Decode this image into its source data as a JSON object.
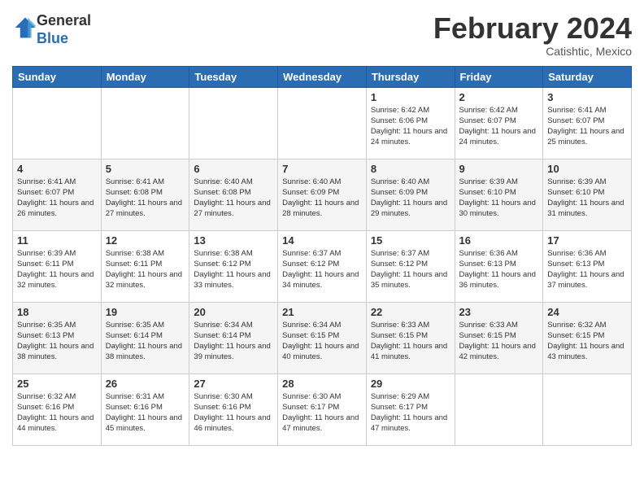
{
  "header": {
    "logo_general": "General",
    "logo_blue": "Blue",
    "month_title": "February 2024",
    "subtitle": "Catishtic, Mexico"
  },
  "days_of_week": [
    "Sunday",
    "Monday",
    "Tuesday",
    "Wednesday",
    "Thursday",
    "Friday",
    "Saturday"
  ],
  "weeks": [
    [
      {
        "day": "",
        "info": ""
      },
      {
        "day": "",
        "info": ""
      },
      {
        "day": "",
        "info": ""
      },
      {
        "day": "",
        "info": ""
      },
      {
        "day": "1",
        "info": "Sunrise: 6:42 AM\nSunset: 6:06 PM\nDaylight: 11 hours and 24 minutes."
      },
      {
        "day": "2",
        "info": "Sunrise: 6:42 AM\nSunset: 6:07 PM\nDaylight: 11 hours and 24 minutes."
      },
      {
        "day": "3",
        "info": "Sunrise: 6:41 AM\nSunset: 6:07 PM\nDaylight: 11 hours and 25 minutes."
      }
    ],
    [
      {
        "day": "4",
        "info": "Sunrise: 6:41 AM\nSunset: 6:07 PM\nDaylight: 11 hours and 26 minutes."
      },
      {
        "day": "5",
        "info": "Sunrise: 6:41 AM\nSunset: 6:08 PM\nDaylight: 11 hours and 27 minutes."
      },
      {
        "day": "6",
        "info": "Sunrise: 6:40 AM\nSunset: 6:08 PM\nDaylight: 11 hours and 27 minutes."
      },
      {
        "day": "7",
        "info": "Sunrise: 6:40 AM\nSunset: 6:09 PM\nDaylight: 11 hours and 28 minutes."
      },
      {
        "day": "8",
        "info": "Sunrise: 6:40 AM\nSunset: 6:09 PM\nDaylight: 11 hours and 29 minutes."
      },
      {
        "day": "9",
        "info": "Sunrise: 6:39 AM\nSunset: 6:10 PM\nDaylight: 11 hours and 30 minutes."
      },
      {
        "day": "10",
        "info": "Sunrise: 6:39 AM\nSunset: 6:10 PM\nDaylight: 11 hours and 31 minutes."
      }
    ],
    [
      {
        "day": "11",
        "info": "Sunrise: 6:39 AM\nSunset: 6:11 PM\nDaylight: 11 hours and 32 minutes."
      },
      {
        "day": "12",
        "info": "Sunrise: 6:38 AM\nSunset: 6:11 PM\nDaylight: 11 hours and 32 minutes."
      },
      {
        "day": "13",
        "info": "Sunrise: 6:38 AM\nSunset: 6:12 PM\nDaylight: 11 hours and 33 minutes."
      },
      {
        "day": "14",
        "info": "Sunrise: 6:37 AM\nSunset: 6:12 PM\nDaylight: 11 hours and 34 minutes."
      },
      {
        "day": "15",
        "info": "Sunrise: 6:37 AM\nSunset: 6:12 PM\nDaylight: 11 hours and 35 minutes."
      },
      {
        "day": "16",
        "info": "Sunrise: 6:36 AM\nSunset: 6:13 PM\nDaylight: 11 hours and 36 minutes."
      },
      {
        "day": "17",
        "info": "Sunrise: 6:36 AM\nSunset: 6:13 PM\nDaylight: 11 hours and 37 minutes."
      }
    ],
    [
      {
        "day": "18",
        "info": "Sunrise: 6:35 AM\nSunset: 6:13 PM\nDaylight: 11 hours and 38 minutes."
      },
      {
        "day": "19",
        "info": "Sunrise: 6:35 AM\nSunset: 6:14 PM\nDaylight: 11 hours and 38 minutes."
      },
      {
        "day": "20",
        "info": "Sunrise: 6:34 AM\nSunset: 6:14 PM\nDaylight: 11 hours and 39 minutes."
      },
      {
        "day": "21",
        "info": "Sunrise: 6:34 AM\nSunset: 6:15 PM\nDaylight: 11 hours and 40 minutes."
      },
      {
        "day": "22",
        "info": "Sunrise: 6:33 AM\nSunset: 6:15 PM\nDaylight: 11 hours and 41 minutes."
      },
      {
        "day": "23",
        "info": "Sunrise: 6:33 AM\nSunset: 6:15 PM\nDaylight: 11 hours and 42 minutes."
      },
      {
        "day": "24",
        "info": "Sunrise: 6:32 AM\nSunset: 6:15 PM\nDaylight: 11 hours and 43 minutes."
      }
    ],
    [
      {
        "day": "25",
        "info": "Sunrise: 6:32 AM\nSunset: 6:16 PM\nDaylight: 11 hours and 44 minutes."
      },
      {
        "day": "26",
        "info": "Sunrise: 6:31 AM\nSunset: 6:16 PM\nDaylight: 11 hours and 45 minutes."
      },
      {
        "day": "27",
        "info": "Sunrise: 6:30 AM\nSunset: 6:16 PM\nDaylight: 11 hours and 46 minutes."
      },
      {
        "day": "28",
        "info": "Sunrise: 6:30 AM\nSunset: 6:17 PM\nDaylight: 11 hours and 47 minutes."
      },
      {
        "day": "29",
        "info": "Sunrise: 6:29 AM\nSunset: 6:17 PM\nDaylight: 11 hours and 47 minutes."
      },
      {
        "day": "",
        "info": ""
      },
      {
        "day": "",
        "info": ""
      }
    ]
  ]
}
